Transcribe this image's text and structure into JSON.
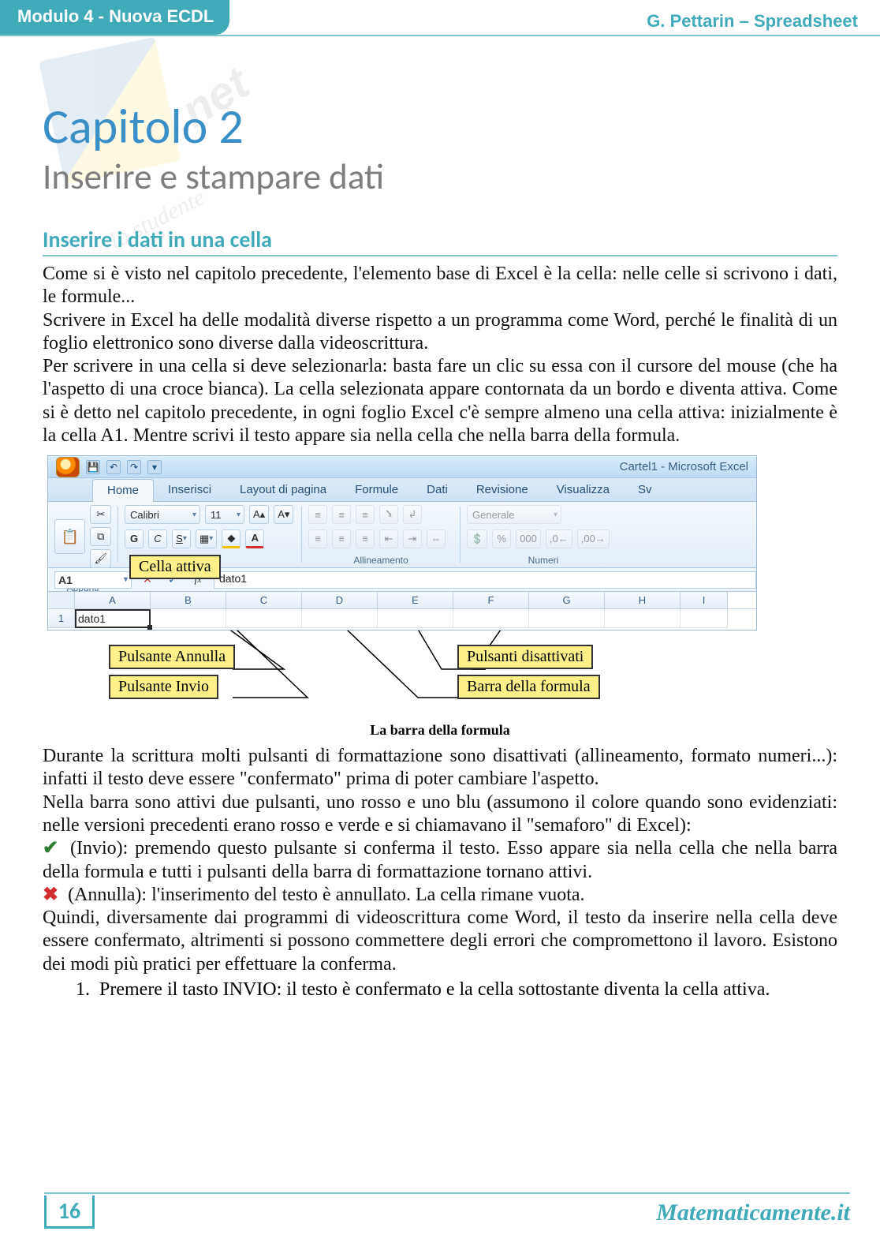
{
  "header": {
    "module": "Modulo 4 - Nuova ECDL",
    "right": "G. Pettarin – Spreadsheet"
  },
  "watermark": {
    "net": ".net",
    "line2": "lo studente"
  },
  "chapter": {
    "title": "Capitolo 2",
    "subtitle": "Inserire e stampare dati"
  },
  "section1_h": "Inserire i dati in una cella",
  "para1": "Come si è visto nel capitolo precedente, l'elemento base di Excel è la cella: nelle celle si scrivono i dati, le formule...",
  "para2": "Scrivere in Excel ha delle modalità diverse rispetto a un programma come Word, perché le finalità di un foglio elettronico sono diverse dalla videoscrittura.",
  "para3": "Per scrivere in una cella si deve selezionarla: basta fare un clic su essa con il cursore del mouse (che ha l'aspetto di una croce bianca). La cella selezionata appare contornata da un bordo e diventa attiva. Come si è detto nel capitolo precedente, in ogni foglio Excel c'è sempre almeno una cella attiva: inizialmente è la cella A1. Mentre scrivi il testo appare sia nella cella che nella barra della formula.",
  "excel": {
    "window_title": "Cartel1 - Microsoft Excel",
    "tabs": [
      "Home",
      "Inserisci",
      "Layout di pagina",
      "Formule",
      "Dati",
      "Revisione",
      "Visualizza",
      "Sv"
    ],
    "clip_label": "Appunti",
    "paste_label": "Incolla",
    "font_name": "Calibri",
    "font_size": "11",
    "align_label": "Allineamento",
    "num_group": "Numeri",
    "num_format": "Generale",
    "pct": "%",
    "thou": "000",
    "dec_inc": ",0←",
    "dec_dec": ",00→",
    "name_box": "A1",
    "formula_value": "dato1",
    "cols": [
      "A",
      "B",
      "C",
      "D",
      "E",
      "F",
      "G",
      "H",
      "I"
    ],
    "row1": "1",
    "a1_value": "dato1"
  },
  "callouts": {
    "cella_attiva": "Cella attiva",
    "pulsante_annulla": "Pulsante Annulla",
    "pulsante_invio": "Pulsante Invio",
    "pulsanti_disattivati": "Pulsanti disattivati",
    "barra_formula": "Barra della formula"
  },
  "fig_caption": "La barra della formula",
  "para4": "Durante la scrittura molti pulsanti di formattazione sono disattivati (allineamento, formato numeri...): infatti il testo deve essere \"confermato\" prima di poter cambiare l'aspetto.",
  "para5": "Nella barra sono attivi due pulsanti, uno rosso e uno blu (assumono il colore quando sono evidenziati: nelle versioni precedenti erano rosso e verde e si chiamavano il \"semaforo\" di Excel):",
  "bullet_invio": " (Invio): premendo questo pulsante si conferma il testo. Esso appare sia nella cella che nella barra della formula e tutti i pulsanti della barra di formattazione tornano attivi.",
  "bullet_annulla": " (Annulla): l'inserimento del testo è annullato. La cella rimane vuota.",
  "para6": "Quindi, diversamente dai programmi di videoscrittura come Word, il testo da inserire nella cella deve essere confermato, altrimenti si possono commettere degli errori che compromettono il lavoro.  Esistono dei modi più pratici per effettuare la conferma.",
  "numlist_1": "Premere il tasto INVIO: il testo è confermato e la cella sottostante diventa la cella attiva.",
  "footer": {
    "page": "16",
    "brand": "Matematicamente.it"
  }
}
